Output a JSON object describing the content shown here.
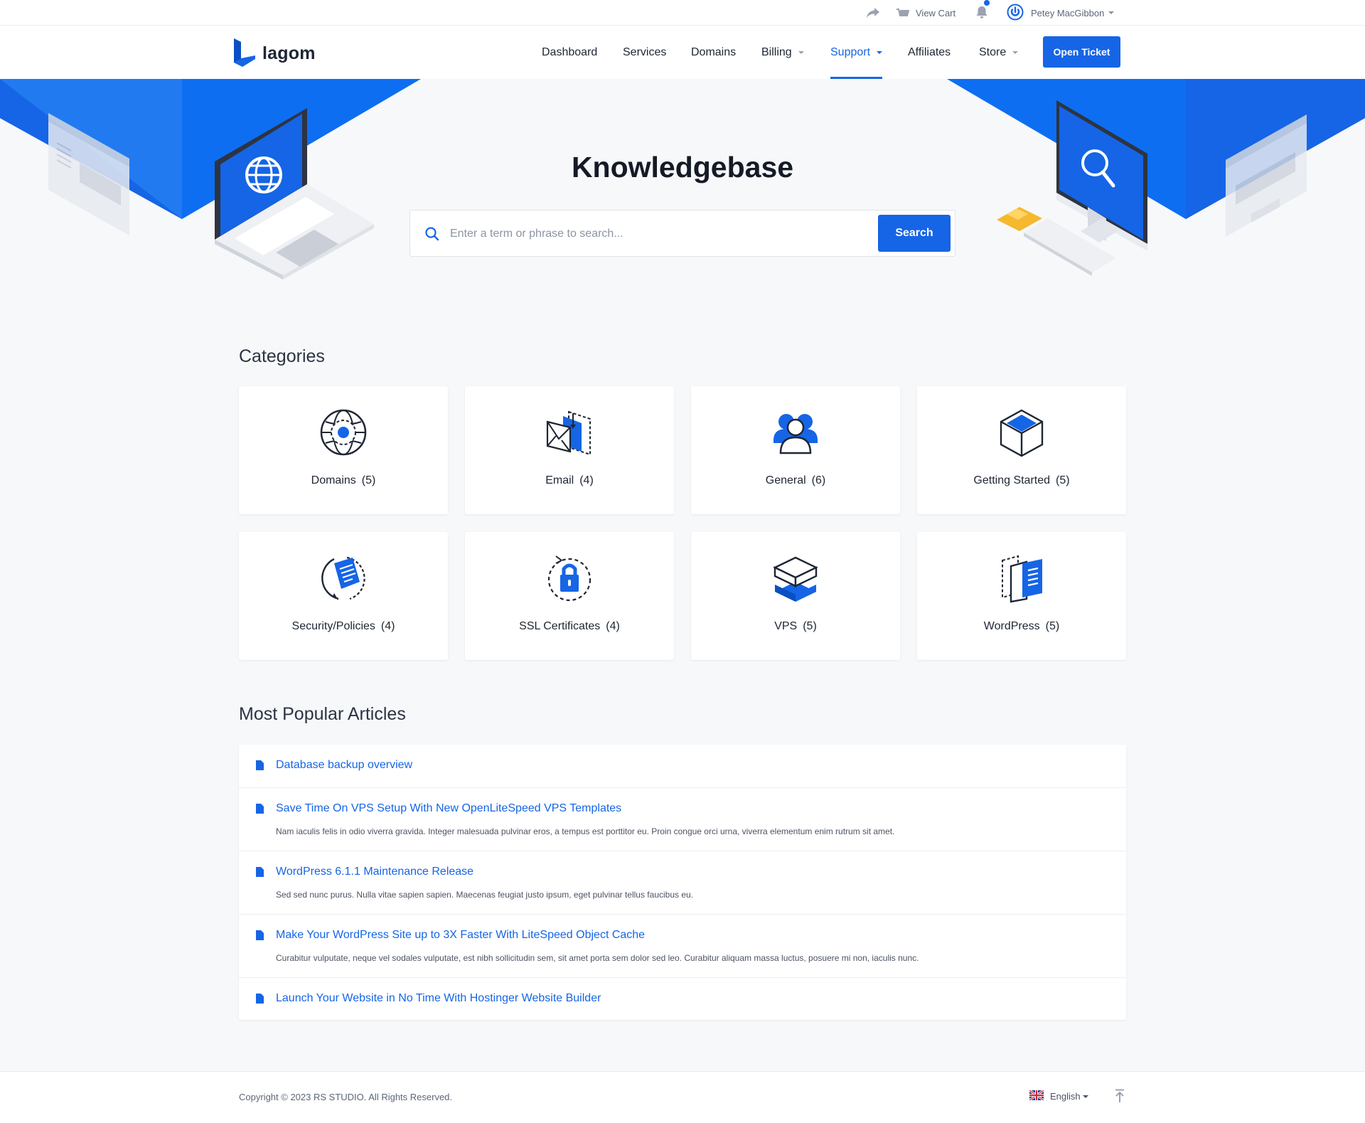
{
  "topbar": {
    "cart_label": "View Cart",
    "user_name": "Petey MacGibbon"
  },
  "nav": {
    "brand": "lagom",
    "items": [
      {
        "label": "Dashboard"
      },
      {
        "label": "Services"
      },
      {
        "label": "Domains"
      },
      {
        "label": "Billing"
      },
      {
        "label": "Support"
      },
      {
        "label": "Affiliates"
      },
      {
        "label": "Store"
      }
    ],
    "cta_label": "Open Ticket"
  },
  "hero": {
    "title": "Knowledgebase",
    "search_placeholder": "Enter a term or phrase to search...",
    "search_button": "Search"
  },
  "categories": {
    "heading": "Categories",
    "items": [
      {
        "name": "Domains",
        "count": "(5)",
        "icon": "globe-icon"
      },
      {
        "name": "Email",
        "count": "(4)",
        "icon": "email-icon"
      },
      {
        "name": "General",
        "count": "(6)",
        "icon": "users-icon"
      },
      {
        "name": "Getting Started",
        "count": "(5)",
        "icon": "cube-icon"
      },
      {
        "name": "Security/Policies",
        "count": "(4)",
        "icon": "security-document-icon"
      },
      {
        "name": "SSL Certificates",
        "count": "(4)",
        "icon": "lock-icon"
      },
      {
        "name": "VPS",
        "count": "(5)",
        "icon": "server-stack-icon"
      },
      {
        "name": "WordPress",
        "count": "(5)",
        "icon": "documents-icon"
      }
    ]
  },
  "articles": {
    "heading": "Most Popular Articles",
    "items": [
      {
        "title": "Database backup overview",
        "desc": ""
      },
      {
        "title": "Save Time On VPS Setup With New OpenLiteSpeed VPS Templates",
        "desc": "Nam iaculis felis in odio viverra gravida. Integer malesuada pulvinar eros, a tempus est porttitor eu. Proin congue orci urna, viverra elementum enim rutrum sit amet."
      },
      {
        "title": "WordPress 6.1.1 Maintenance Release",
        "desc": "Sed sed nunc purus. Nulla vitae sapien sapien. Maecenas feugiat justo ipsum, eget pulvinar tellus faucibus eu."
      },
      {
        "title": "Make Your WordPress Site up to 3X Faster With LiteSpeed Object Cache",
        "desc": "Curabitur vulputate, neque vel sodales vulputate, est nibh sollicitudin sem, sit amet porta sem dolor sed leo. Curabitur aliquam massa luctus, posuere mi non, iaculis nunc."
      },
      {
        "title": "Launch Your Website in No Time With Hostinger Website Builder",
        "desc": ""
      }
    ]
  },
  "footer": {
    "copyright": "Copyright © 2023 RS STUDIO. All Rights Reserved.",
    "language": "English"
  },
  "colors": {
    "primary": "#1565e6",
    "hero_blue": "#0d6ef2",
    "text_dark": "#1d2633",
    "background": "#f7f8fa",
    "accent_yellow": "#f5b82e"
  }
}
